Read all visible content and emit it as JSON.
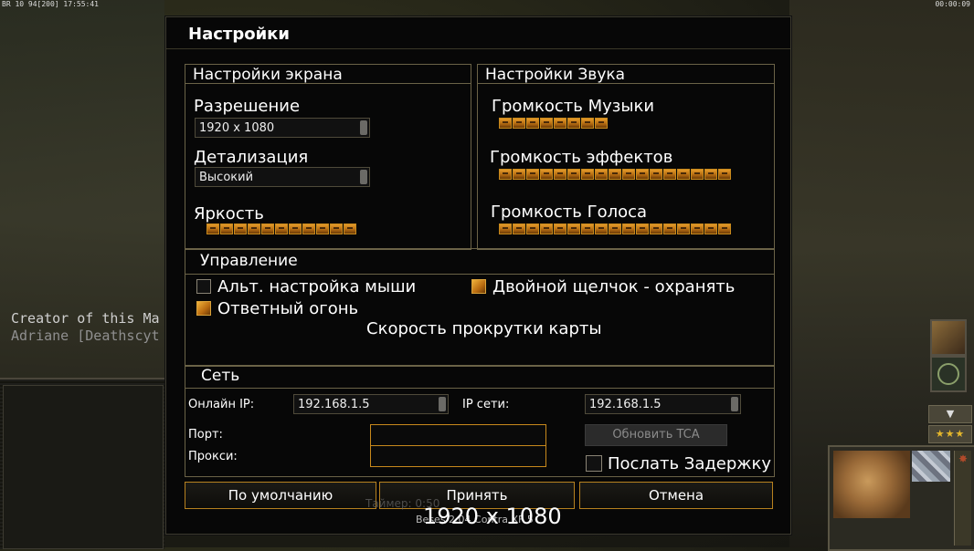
{
  "hud": {
    "top_left": "ВR 10 94[200] 17:55:41",
    "top_right": "00:00:09"
  },
  "background": {
    "credits_line1": "Creator of this Ma",
    "credits_line2": "Adriane [Deathscyt"
  },
  "dialog": {
    "title": "Настройки",
    "screen": {
      "header": "Настройки экрана",
      "resolution_label": "Разрешение",
      "resolution_value": "1920 x 1080",
      "detail_label": "Детализация",
      "detail_value": "Высокий",
      "brightness_label": "Яркость",
      "brightness_level": 11
    },
    "sound": {
      "header": "Настройки Звука",
      "music_label": "Громкость Музыки",
      "music_level": 8,
      "effects_label": "Громкость эффектов",
      "effects_level": 17,
      "voice_label": "Громкость Голоса",
      "voice_level": 17
    },
    "control": {
      "header": "Управление",
      "alt_mouse_label": "Альт. настройка мыши",
      "alt_mouse_checked": false,
      "double_click_label": "Двойной щелчок - охранять",
      "double_click_checked": true,
      "return_fire_label": "Ответный огонь",
      "return_fire_checked": true,
      "scroll_speed_label": "Скорость прокрутки карты"
    },
    "network": {
      "header": "Сеть",
      "online_ip_label": "Онлайн IP:",
      "online_ip_value": "192.168.1.5",
      "lan_ip_label": "IP сети:",
      "lan_ip_value": "192.168.1.5",
      "port_label": "Порт:",
      "port_value": "",
      "proxy_label": "Прокси:",
      "proxy_value": "",
      "update_tca_label": "Обновить TCA",
      "send_delay_label": "Послать Задержку",
      "send_delay_checked": false
    },
    "buttons": {
      "defaults": "По умолчанию",
      "accept": "Принять",
      "cancel": "Отмена"
    }
  },
  "overlay": {
    "resolution_text": "1920 x 1080",
    "timer_ghost": "Таймер: 0:50",
    "version_ghost": "Beses 2.04 Contra XF 5"
  },
  "colors": {
    "accent_orange": "#c8891c",
    "section_border": "#6b6347",
    "dialog_bg": "#070707"
  }
}
